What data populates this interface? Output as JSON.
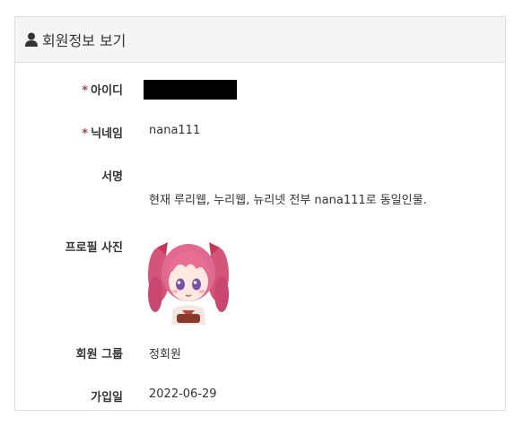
{
  "panel": {
    "title": "회원정보 보기",
    "icon": "user-icon"
  },
  "fields": {
    "userid": {
      "label": "아이디",
      "required_mark": "*",
      "value": ""
    },
    "nickname": {
      "label": "닉네임",
      "required_mark": "*",
      "value": "nana111"
    },
    "signature": {
      "label": "서명",
      "value": "현재 루리웹, 누리웹, 뉴리넷 전부 nana111로 동일인물."
    },
    "photo": {
      "label": "프로필 사진",
      "image": "anime-girl-avatar"
    },
    "group": {
      "label": "회원 그룹",
      "value": "정회원"
    },
    "joined": {
      "label": "가입일",
      "value": "2022-06-29"
    }
  },
  "colors": {
    "required": "#a94442",
    "heading_bg": "#f5f5f5",
    "border": "#dddddd"
  }
}
